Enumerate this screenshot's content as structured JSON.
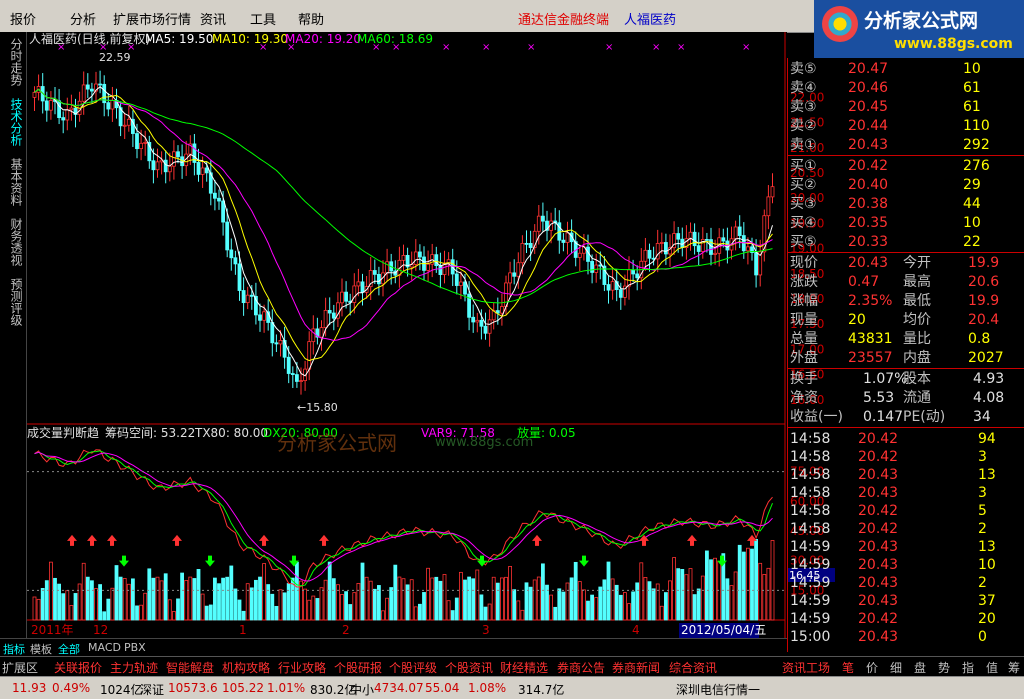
{
  "menu": {
    "items": [
      "报价",
      "分析",
      "扩展市场行情",
      "资讯",
      "工具",
      "帮助"
    ],
    "terminal": "通达信金融终端",
    "stock_name": "人福医药"
  },
  "logo": {
    "title": "分析家公式网",
    "url": "www.88gs.com"
  },
  "left_tabs": [
    "分时走势",
    "技术分析",
    "基本资料",
    "财务透视",
    "预测评级"
  ],
  "main_chart": {
    "title": "人福医药(日线,前复权)",
    "ma5": "MA5: 19.50",
    "ma10": "MA10: 19.30",
    "ma20": "MA20: 19.20",
    "ma60": "MA60: 18.69",
    "yticks": [
      "22.00",
      "21.50",
      "21.00",
      "20.50",
      "20.00",
      "19.50",
      "19.00",
      "18.50",
      "18.00",
      "17.50",
      "17.00",
      "16.50",
      "16.00"
    ],
    "high_label": "22.59",
    "low_label": "←15.80"
  },
  "sub_chart": {
    "title": "成交量判断趋",
    "chip": "筹码空间: 53.22",
    "tx80": "TX80: 80.00",
    "dx": "DX20: 80.00",
    "var9": "VAR9: 71.58",
    "vol": "放量: 0.05",
    "watermark": "分析家公式网",
    "watermark_url": "www.88gs.com",
    "yticks": [
      "75.00",
      "60.00",
      "45.00",
      "30.00",
      "15.00"
    ],
    "cursor_value": "16.45"
  },
  "time_axis": [
    "2011年",
    "12",
    "1",
    "2",
    "3",
    "4"
  ],
  "time_cursor": "2012/05/04/五",
  "period": "日线",
  "chart_data": {
    "type": "candlestick",
    "title": "人福医药(日线,前复权)",
    "ylim": [
      15.6,
      22.9
    ],
    "high": 22.59,
    "low": 15.8,
    "series_ma": [
      {
        "name": "MA5",
        "value": 19.5,
        "color": "#ffffff"
      },
      {
        "name": "MA10",
        "value": 19.3,
        "color": "#ffff00"
      },
      {
        "name": "MA20",
        "value": 19.2,
        "color": "#ff00ff"
      },
      {
        "name": "MA60",
        "value": 18.69,
        "color": "#00ff00"
      }
    ]
  },
  "quote": {
    "sell": [
      {
        "label": "卖⑤",
        "price": "20.47",
        "vol": "10"
      },
      {
        "label": "卖④",
        "price": "20.46",
        "vol": "61"
      },
      {
        "label": "卖③",
        "price": "20.45",
        "vol": "61"
      },
      {
        "label": "卖②",
        "price": "20.44",
        "vol": "110"
      },
      {
        "label": "卖①",
        "price": "20.43",
        "vol": "292"
      }
    ],
    "buy": [
      {
        "label": "买①",
        "price": "20.42",
        "vol": "276"
      },
      {
        "label": "买②",
        "price": "20.40",
        "vol": "29"
      },
      {
        "label": "买③",
        "price": "20.38",
        "vol": "44"
      },
      {
        "label": "买④",
        "price": "20.35",
        "vol": "10"
      },
      {
        "label": "买⑤",
        "price": "20.33",
        "vol": "22"
      }
    ],
    "stats": [
      {
        "l1": "现价",
        "v1": "20.43",
        "l2": "今开",
        "v2": "19.9"
      },
      {
        "l1": "涨跌",
        "v1": "0.47",
        "l2": "最高",
        "v2": "20.6"
      },
      {
        "l1": "涨幅",
        "v1": "2.35%",
        "l2": "最低",
        "v2": "19.9"
      },
      {
        "l1": "现量",
        "v1": "20",
        "l2": "均价",
        "v2": "20.4"
      },
      {
        "l1": "总量",
        "v1": "43831",
        "l2": "量比",
        "v2": "0.8"
      },
      {
        "l1": "外盘",
        "v1": "23557",
        "l2": "内盘",
        "v2": "2027"
      }
    ],
    "fund": [
      {
        "l1": "换手",
        "v1": "1.07%",
        "l2": "股本",
        "v2": "4.93"
      },
      {
        "l1": "净资",
        "v1": "5.53",
        "l2": "流通",
        "v2": "4.08"
      },
      {
        "l1": "收益(一)",
        "v1": "0.147",
        "l2": "PE(动)",
        "v2": "34"
      }
    ],
    "ticks": [
      {
        "t": "14:58",
        "p": "20.42",
        "v": "94"
      },
      {
        "t": "14:58",
        "p": "20.42",
        "v": "3"
      },
      {
        "t": "14:58",
        "p": "20.43",
        "v": "13"
      },
      {
        "t": "14:58",
        "p": "20.43",
        "v": "3"
      },
      {
        "t": "14:58",
        "p": "20.42",
        "v": "5"
      },
      {
        "t": "14:58",
        "p": "20.42",
        "v": "2"
      },
      {
        "t": "14:59",
        "p": "20.43",
        "v": "13"
      },
      {
        "t": "14:59",
        "p": "20.43",
        "v": "10"
      },
      {
        "t": "14:59",
        "p": "20.43",
        "v": "2"
      },
      {
        "t": "14:59",
        "p": "20.43",
        "v": "37"
      },
      {
        "t": "14:59",
        "p": "20.42",
        "v": "20"
      },
      {
        "t": "15:00",
        "p": "20.43",
        "v": "0"
      }
    ]
  },
  "bottom_tabs": [
    "指标",
    "模板",
    "全部",
    "MACD",
    "PBX"
  ],
  "nav": [
    "扩展区",
    "关联报价",
    "主力轨迹",
    "智能解盘",
    "机构攻略",
    "行业攻略",
    "个股研报",
    "个股评级",
    "个股资讯",
    "财经精选",
    "券商公告",
    "券商新闻",
    "综合资讯",
    "资讯工场"
  ],
  "right_tabs": [
    "笔",
    "价",
    "细",
    "盘",
    "势",
    "指",
    "值",
    "筹"
  ],
  "status": {
    "sh_price": "11.93",
    "sh_pct": "0.49%",
    "sh_amt": "1024亿",
    "sz_label": "深证",
    "sz_price": "10573.6",
    "sz_chg": "105.22",
    "sz_pct": "1.01%",
    "sz_amt": "830.2亿",
    "zx_label": "中小",
    "zx_price": "4734.07",
    "zx_chg": "55.04",
    "zx_pct": "1.08%",
    "zx_amt": "314.7亿",
    "server": "深圳电信行情一"
  }
}
